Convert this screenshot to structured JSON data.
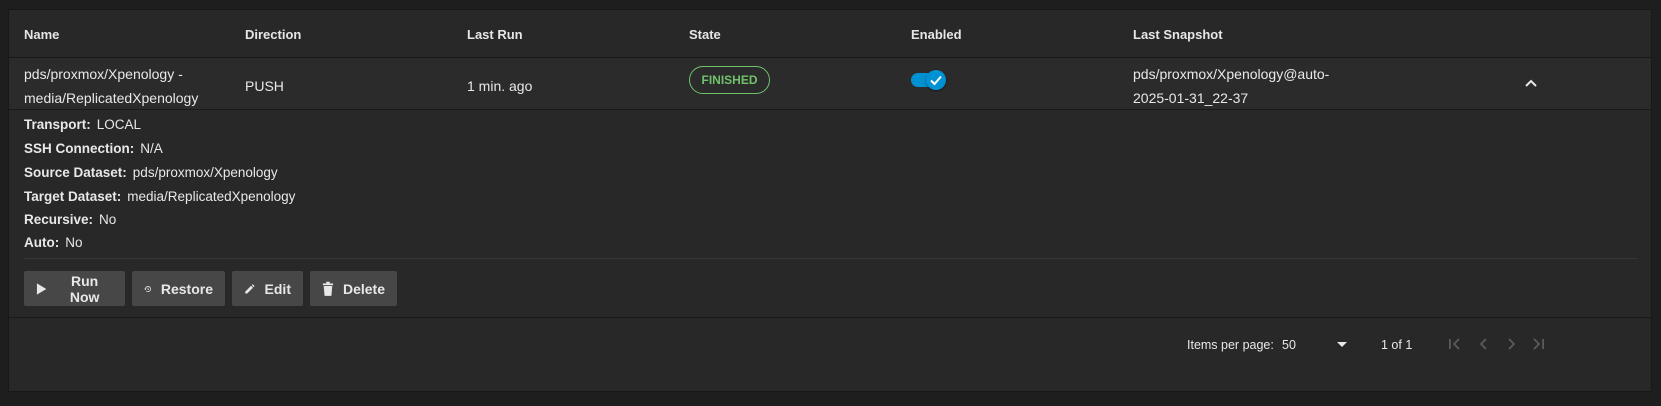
{
  "columns": {
    "name": "Name",
    "direction": "Direction",
    "last_run": "Last Run",
    "state": "State",
    "enabled": "Enabled",
    "last_snapshot": "Last Snapshot"
  },
  "row": {
    "name_line1": "pds/proxmox/Xpenology -",
    "name_line2": "media/ReplicatedXpenology",
    "direction": "PUSH",
    "last_run": "1 min. ago",
    "state": "FINISHED",
    "enabled": true,
    "snapshot_line1": "pds/proxmox/Xpenology@auto-",
    "snapshot_line2": "2025-01-31_22-37"
  },
  "details": [
    {
      "label": "Transport:",
      "value": "LOCAL"
    },
    {
      "label": "SSH Connection:",
      "value": "N/A"
    },
    {
      "label": "Source Dataset:",
      "value": "pds/proxmox/Xpenology"
    },
    {
      "label": "Target Dataset:",
      "value": "media/ReplicatedXpenology"
    },
    {
      "label": "Recursive:",
      "value": "No"
    },
    {
      "label": "Auto:",
      "value": "No"
    }
  ],
  "actions": {
    "run_now": "Run Now",
    "restore": "Restore",
    "edit": "Edit",
    "delete": "Delete"
  },
  "paginator": {
    "items_per_page_label": "Items per page:",
    "items_per_page_value": "50",
    "range": "1 of 1"
  },
  "colors": {
    "accent": "#0091d3",
    "finished": "#71c16b",
    "button": "#474747"
  },
  "icons": {
    "expand": "chevron-up-icon",
    "run": "play-icon",
    "restore": "history-icon",
    "edit": "pencil-icon",
    "delete": "trash-icon",
    "toggle": "check-icon",
    "first_page": "first-page-icon",
    "prev_page": "chevron-left-icon",
    "next_page": "chevron-right-icon",
    "last_page": "last-page-icon"
  }
}
